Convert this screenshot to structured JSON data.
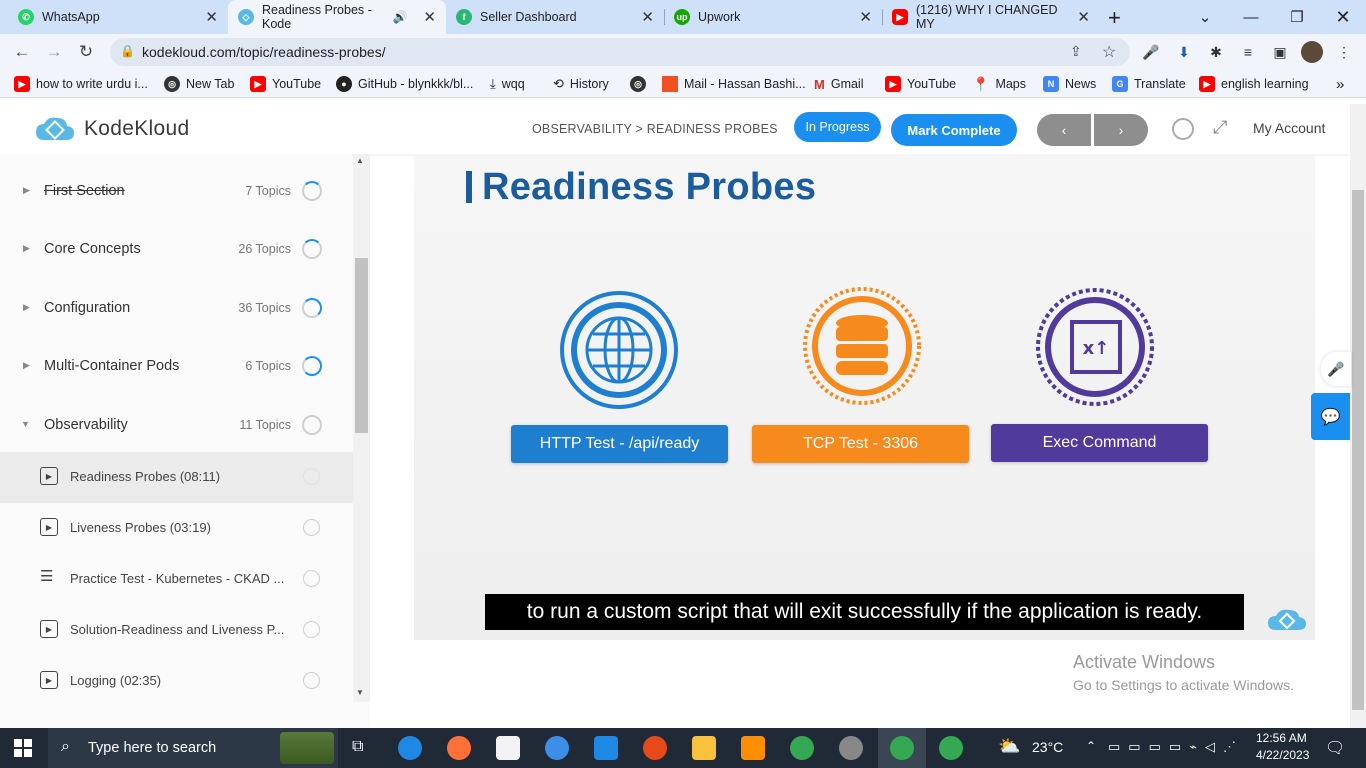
{
  "browser": {
    "tabs": [
      {
        "title": "WhatsApp"
      },
      {
        "title": "Readiness Probes - Kode"
      },
      {
        "title": "Seller Dashboard"
      },
      {
        "title": "Upwork"
      },
      {
        "title": "(1216) WHY I CHANGED MY"
      }
    ],
    "new_tab": "+",
    "url": "kodekloud.com/topic/readiness-probes/",
    "bookmarks": [
      {
        "label": "how to write urdu i..."
      },
      {
        "label": "New Tab"
      },
      {
        "label": "YouTube"
      },
      {
        "label": "GitHub - blynkkk/bl..."
      },
      {
        "label": "wqq"
      },
      {
        "label": "History"
      },
      {
        "label": ""
      },
      {
        "label": "Mail - Hassan Bashi..."
      },
      {
        "label": "Gmail"
      },
      {
        "label": "YouTube"
      },
      {
        "label": "Maps"
      },
      {
        "label": "News"
      },
      {
        "label": "Translate"
      },
      {
        "label": "english learning"
      }
    ],
    "more_bookmarks": "»"
  },
  "site": {
    "logo": "KodeKloud",
    "breadcrumb": "OBSERVABILITY > READINESS PROBES",
    "in_progress": "In Progress",
    "mark_complete": "Mark Complete",
    "prev": "‹",
    "next": "›",
    "my_account": "My Account"
  },
  "sidebar": {
    "sections": [
      {
        "title": "First Section",
        "count": "7 Topics"
      },
      {
        "title": "Core Concepts",
        "count": "26 Topics"
      },
      {
        "title": "Configuration",
        "count": "36 Topics"
      },
      {
        "title": "Multi-Container Pods",
        "count": "6 Topics"
      },
      {
        "title": "Observability",
        "count": "11 Topics"
      }
    ],
    "lessons": [
      {
        "title": "Readiness Probes (08:11)"
      },
      {
        "title": "Liveness Probes (03:19)"
      },
      {
        "title": "Practice Test - Kubernetes - CKAD ..."
      },
      {
        "title": "Solution-Readiness and Liveness P..."
      },
      {
        "title": "Logging (02:35)"
      }
    ]
  },
  "video": {
    "title": "Readiness Probes",
    "pills": [
      {
        "label": "HTTP Test - /api/ready",
        "color": "#1e7fd0"
      },
      {
        "label": "TCP Test - 3306",
        "color": "#f78a1d"
      },
      {
        "label": "Exec Command",
        "color": "#503a9b"
      }
    ],
    "caption": "to run a custom script that will exit successfully if the application is ready."
  },
  "watermark": {
    "line1": "Activate Windows",
    "line2": "Go to Settings to activate Windows."
  },
  "taskbar": {
    "search_placeholder": "Type here to search",
    "temperature": "23°C",
    "time": "12:56 AM",
    "date": "4/22/2023"
  }
}
